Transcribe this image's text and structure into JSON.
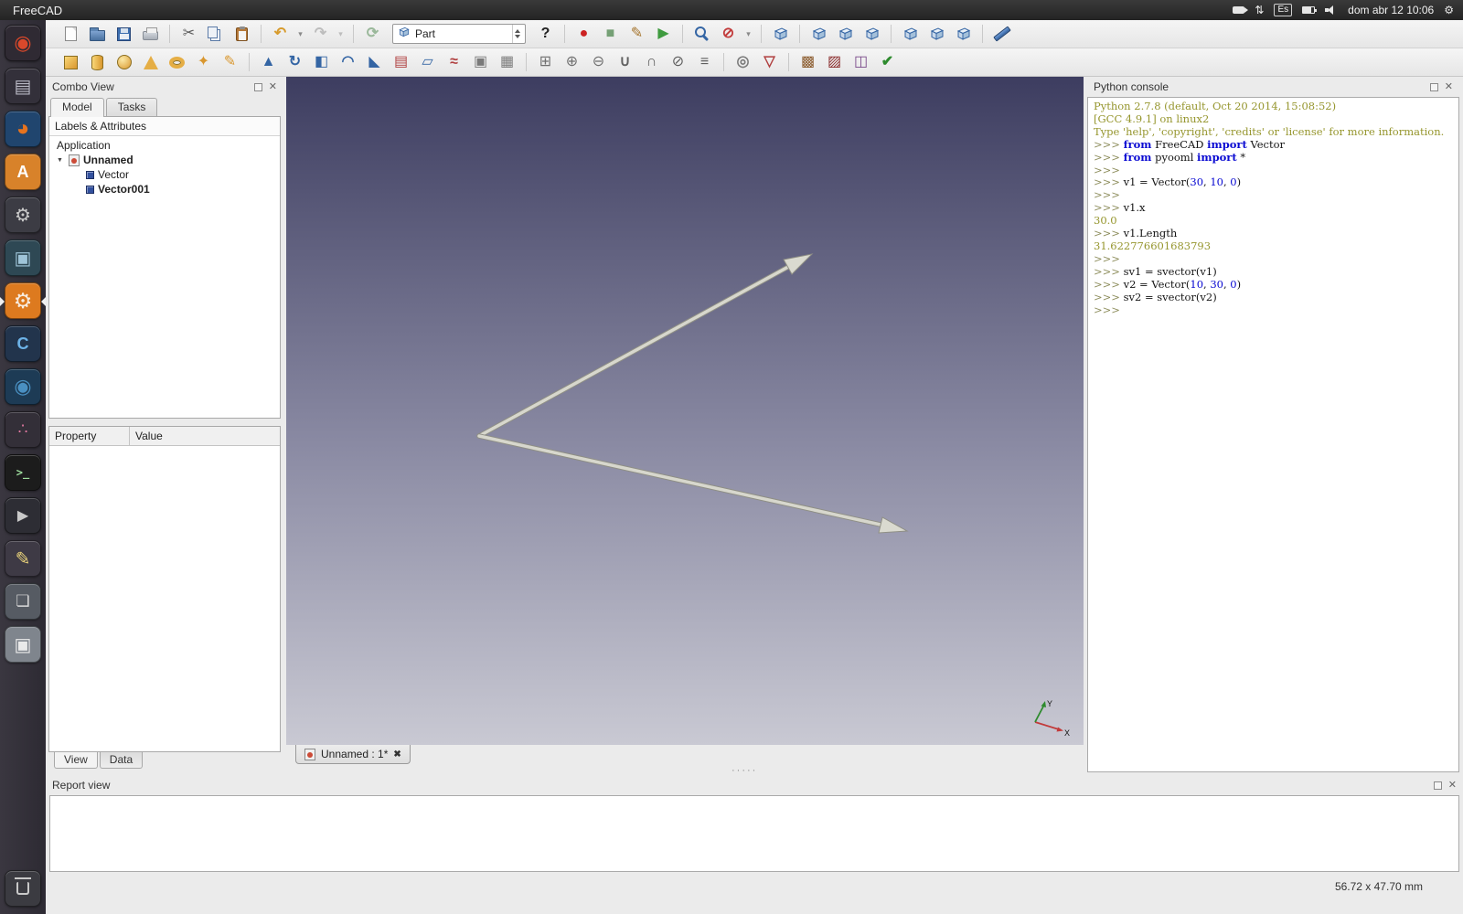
{
  "icons": {
    "close": "✕",
    "close_bold": "✖",
    "expander": "▼",
    "dots": "·····"
  },
  "top_bar": {
    "title": "FreeCAD",
    "indicators": [
      {
        "name": "screen-record-icon",
        "kind": "cls",
        "cls": "tb-cam"
      },
      {
        "name": "network-sync-icon",
        "kind": "glyph",
        "glyph": "⇅"
      },
      {
        "name": "keyboard-layout-indicator",
        "kind": "badge",
        "text": "Es"
      },
      {
        "name": "battery-icon",
        "kind": "cls",
        "cls": "tb-batt"
      },
      {
        "name": "volume-icon",
        "kind": "cls",
        "cls": "tb-vol"
      },
      {
        "name": "clock",
        "kind": "text",
        "text": "dom abr 12 10:06"
      },
      {
        "name": "session-menu-icon",
        "kind": "glyph",
        "glyph": "⚙"
      }
    ]
  },
  "launcher": {
    "items": [
      {
        "name": "launcher-ubuntu-dash",
        "bg": "#2f2a33",
        "glyph": "◉",
        "fg": "#d9482b",
        "size": 22
      },
      {
        "name": "launcher-files",
        "bg": "#33303a",
        "glyph": "▤",
        "fg": "#b9b9c5"
      },
      {
        "name": "launcher-firefox",
        "bg": "#20456e",
        "glyph": "◕",
        "fg": "#e6731e",
        "size": 24
      },
      {
        "name": "launcher-software-center",
        "bg": "#d8822a",
        "glyph": "A",
        "fg": "#ffffff",
        "bold": true,
        "size": 18
      },
      {
        "name": "launcher-system-tools",
        "bg": "#3c3c44",
        "glyph": "⚙",
        "fg": "#c9c9c9"
      },
      {
        "name": "launcher-workspace",
        "bg": "#2e4854",
        "glyph": "▣",
        "fg": "#9fc4d8"
      },
      {
        "name": "launcher-freecad",
        "bg": "#dd7a1f",
        "glyph": "⚙",
        "fg": "#f7ece0",
        "active": true,
        "size": 23
      },
      {
        "name": "launcher-cpp-ide",
        "bg": "#22344c",
        "glyph": "C",
        "fg": "#6db3e8",
        "bold": true,
        "size": 18
      },
      {
        "name": "launcher-web-browser",
        "bg": "#1d3b55",
        "glyph": "◉",
        "fg": "#4a90c2",
        "size": 22
      },
      {
        "name": "launcher-media-app",
        "bg": "#332f38",
        "glyph": "∴",
        "fg": "#e078a0",
        "size": 17
      },
      {
        "name": "launcher-terminal",
        "bg": "#1c1c1c",
        "glyph": ">_",
        "fg": "#9fe09f",
        "mono": true,
        "size": 12,
        "bold": true
      },
      {
        "name": "launcher-video-player",
        "bg": "#2d2d34",
        "glyph": "▶",
        "fg": "#c9c9c9",
        "size": 16
      },
      {
        "name": "launcher-text-editor",
        "bg": "#3e3a45",
        "glyph": "✎",
        "fg": "#e8d27a"
      },
      {
        "name": "launcher-window-manager",
        "bg": "#565b63",
        "glyph": "❏",
        "fg": "#d9d9d9",
        "size": 17
      },
      {
        "name": "launcher-file-manager",
        "bg": "#7f858d",
        "glyph": "▣",
        "fg": "#eaeaea"
      },
      {
        "name": "launcher-trash",
        "bg": "#3b3b41",
        "cls": "bin",
        "trash": true
      }
    ]
  },
  "toolbars": {
    "workbench_selector": "Part",
    "row1_left": [
      {
        "name": "new-document-button",
        "kind": "cls",
        "cls": "ic-doc"
      },
      {
        "name": "open-document-button",
        "kind": "cls",
        "cls": "ic-folder"
      },
      {
        "name": "save-document-button",
        "kind": "cls",
        "cls": "ic-save"
      },
      {
        "name": "print-button",
        "kind": "cls",
        "cls": "ic-print"
      },
      {
        "kind": "sep"
      },
      {
        "name": "cut-button",
        "kind": "glyph",
        "glyph": "✂",
        "color": "#5a5a5a"
      },
      {
        "name": "copy-button",
        "kind": "cls",
        "cls": "ic-copy"
      },
      {
        "name": "paste-button",
        "kind": "cls",
        "cls": "ic-paste"
      },
      {
        "kind": "sep"
      },
      {
        "name": "undo-button",
        "kind": "glyph",
        "glyph": "↶",
        "color": "#d79b2c",
        "bold": true
      },
      {
        "name": "undo-menu-arrow",
        "kind": "glyph",
        "glyph": "▾",
        "color": "#8a8a8a",
        "small": true
      },
      {
        "name": "redo-button",
        "kind": "glyph",
        "glyph": "↷",
        "color": "#bdbdbd",
        "bold": true
      },
      {
        "name": "redo-menu-arrow",
        "kind": "glyph",
        "glyph": "▾",
        "color": "#bdbdbd",
        "small": true
      },
      {
        "kind": "sep"
      },
      {
        "name": "refresh-button",
        "kind": "glyph",
        "glyph": "⟳",
        "color": "#9ab89a",
        "bold": true
      }
    ],
    "row1_right": [
      {
        "name": "whats-this-button",
        "kind": "glyph",
        "glyph": "?",
        "color": "#222222",
        "bold": true
      },
      {
        "kind": "sep"
      },
      {
        "name": "macro-record-button",
        "kind": "glyph",
        "glyph": "●",
        "color": "#cc2222"
      },
      {
        "name": "macro-stop-button",
        "kind": "glyph",
        "glyph": "■",
        "color": "#75a075"
      },
      {
        "name": "macro-edit-button",
        "kind": "glyph",
        "glyph": "✎",
        "color": "#a5742c"
      },
      {
        "name": "macro-execute-button",
        "kind": "glyph",
        "glyph": "▶",
        "color": "#3f9b3f"
      },
      {
        "kind": "sep"
      },
      {
        "name": "fit-all-button",
        "kind": "cls",
        "cls": "ic-zoom"
      },
      {
        "name": "draw-style-button",
        "kind": "glyph",
        "glyph": "⊘",
        "color": "#c23b3b",
        "bold": true
      },
      {
        "name": "draw-style-arrow",
        "kind": "glyph",
        "glyph": "▾",
        "color": "#8a8a8a",
        "small": true
      },
      {
        "kind": "sep"
      },
      {
        "name": "view-axonometric-button",
        "kind": "cube"
      },
      {
        "kind": "sep"
      },
      {
        "name": "view-front-button",
        "kind": "cube"
      },
      {
        "name": "view-top-button",
        "kind": "cube"
      },
      {
        "name": "view-right-button",
        "kind": "cube"
      },
      {
        "kind": "sep"
      },
      {
        "name": "view-rear-button",
        "kind": "cube"
      },
      {
        "name": "view-bottom-button",
        "kind": "cube"
      },
      {
        "name": "view-left-button",
        "kind": "cube"
      },
      {
        "kind": "sep"
      },
      {
        "name": "measure-distance-button",
        "kind": "cls",
        "cls": "ic-ruler"
      }
    ],
    "row2": [
      {
        "name": "part-box-button",
        "kind": "cls",
        "cls": "shp-box"
      },
      {
        "name": "part-cylinder-button",
        "kind": "cls",
        "cls": "shp-cyl"
      },
      {
        "name": "part-sphere-button",
        "kind": "cls",
        "cls": "shp-sph"
      },
      {
        "name": "part-cone-button",
        "kind": "cls",
        "cls": "shp-cone"
      },
      {
        "name": "part-torus-button",
        "kind": "cls",
        "cls": "shp-torus"
      },
      {
        "name": "part-create-primitives-button",
        "kind": "glyph",
        "glyph": "✦",
        "color": "#d9972f"
      },
      {
        "name": "part-shape-builder-button",
        "kind": "glyph",
        "glyph": "✎",
        "color": "#d9972f"
      },
      {
        "kind": "sep"
      },
      {
        "name": "part-extrude-button",
        "kind": "glyph",
        "glyph": "▲",
        "color": "#3465a4"
      },
      {
        "name": "part-revolve-button",
        "kind": "glyph",
        "glyph": "↻",
        "color": "#3465a4",
        "bold": true
      },
      {
        "name": "part-mirror-button",
        "kind": "glyph",
        "glyph": "◧",
        "color": "#3465a4"
      },
      {
        "name": "part-fillet-button",
        "kind": "glyph",
        "glyph": "◠",
        "color": "#3465a4",
        "bold": true
      },
      {
        "name": "part-chamfer-button",
        "kind": "glyph",
        "glyph": "◣",
        "color": "#3465a4"
      },
      {
        "name": "part-ruled-surface-button",
        "kind": "glyph",
        "glyph": "▤",
        "color": "#b04040"
      },
      {
        "name": "part-loft-button",
        "kind": "glyph",
        "glyph": "▱",
        "color": "#3465a4"
      },
      {
        "name": "part-sweep-button",
        "kind": "glyph",
        "glyph": "≈",
        "color": "#b04040",
        "bold": true
      },
      {
        "name": "part-offset-button",
        "kind": "glyph",
        "glyph": "▣",
        "color": "#7a7a7a"
      },
      {
        "name": "part-thickness-button",
        "kind": "glyph",
        "glyph": "▦",
        "color": "#7a7a7a"
      },
      {
        "kind": "sep"
      },
      {
        "name": "part-compound-button",
        "kind": "glyph",
        "glyph": "⊞",
        "color": "#6f6f6f"
      },
      {
        "name": "part-boolean-button",
        "kind": "glyph",
        "glyph": "⊕",
        "color": "#6f6f6f"
      },
      {
        "name": "part-cut-button",
        "kind": "glyph",
        "glyph": "⊖",
        "color": "#6f6f6f"
      },
      {
        "name": "part-union-button",
        "kind": "glyph",
        "glyph": "∪",
        "color": "#5f5f5f",
        "bold": true
      },
      {
        "name": "part-common-button",
        "kind": "glyph",
        "glyph": "∩",
        "color": "#5f5f5f",
        "bold": true
      },
      {
        "name": "part-section-button",
        "kind": "glyph",
        "glyph": "⊘",
        "color": "#5f5f5f"
      },
      {
        "name": "part-cross-sections-button",
        "kind": "glyph",
        "glyph": "≡",
        "color": "#5f5f5f",
        "bold": true
      },
      {
        "kind": "sep"
      },
      {
        "name": "part-3d-offset-button",
        "kind": "glyph",
        "glyph": "◎",
        "color": "#7a7a7a",
        "bold": true
      },
      {
        "name": "part-defeaturing-button",
        "kind": "glyph",
        "glyph": "▽",
        "color": "#b04040",
        "bold": true
      },
      {
        "kind": "sep"
      },
      {
        "name": "part-shape-from-mesh-button",
        "kind": "glyph",
        "glyph": "▩",
        "color": "#8a5a2c"
      },
      {
        "name": "part-convert-to-solid-button",
        "kind": "glyph",
        "glyph": "▨",
        "color": "#8a2c2c"
      },
      {
        "name": "part-reverse-shapes-button",
        "kind": "glyph",
        "glyph": "◫",
        "color": "#7a4a8a"
      },
      {
        "name": "part-check-geometry-button",
        "kind": "glyph",
        "glyph": "✔",
        "color": "#2e8b2e",
        "bold": true
      }
    ]
  },
  "combo_view": {
    "title": "Combo View",
    "tabs": [
      "Model",
      "Tasks"
    ],
    "section_header": "Labels & Attributes",
    "tree": {
      "root_label": "Application",
      "document_label": "Unnamed",
      "items": [
        {
          "label": "Vector",
          "bold": false
        },
        {
          "label": "Vector001",
          "bold": true
        }
      ]
    },
    "property_headers": [
      "Property",
      "Value"
    ],
    "bottom_tabs": [
      "View",
      "Data"
    ]
  },
  "document_tab": {
    "label": "Unnamed : 1*"
  },
  "python_console": {
    "title": "Python console",
    "lines": [
      [
        {
          "t": "Python 2.7.8 (default, Oct 20 2014, 15:08:52)",
          "c": "sys"
        }
      ],
      [
        {
          "t": "[GCC 4.9.1] on linux2",
          "c": "sys"
        }
      ],
      [
        {
          "t": "Type 'help', 'copyright', 'credits' or 'license' for more information.",
          "c": "sys"
        }
      ],
      [
        {
          "t": ">>> ",
          "c": "prompt"
        },
        {
          "t": "from",
          "c": "kw"
        },
        {
          "t": " FreeCAD ",
          "c": "txt"
        },
        {
          "t": "import",
          "c": "kw"
        },
        {
          "t": " Vector",
          "c": "txt"
        }
      ],
      [
        {
          "t": ">>> ",
          "c": "prompt"
        },
        {
          "t": "from",
          "c": "kw"
        },
        {
          "t": " pyooml ",
          "c": "txt"
        },
        {
          "t": "import",
          "c": "kw"
        },
        {
          "t": " *",
          "c": "txt"
        }
      ],
      [
        {
          "t": ">>> ",
          "c": "prompt"
        }
      ],
      [
        {
          "t": ">>> ",
          "c": "prompt"
        },
        {
          "t": "v1 = Vector(",
          "c": "txt"
        },
        {
          "t": "30",
          "c": "num"
        },
        {
          "t": ", ",
          "c": "txt"
        },
        {
          "t": "10",
          "c": "num"
        },
        {
          "t": ", ",
          "c": "txt"
        },
        {
          "t": "0",
          "c": "num"
        },
        {
          "t": ")",
          "c": "txt"
        }
      ],
      [
        {
          "t": ">>> ",
          "c": "prompt"
        }
      ],
      [
        {
          "t": ">>> ",
          "c": "prompt"
        },
        {
          "t": "v1.x",
          "c": "txt"
        }
      ],
      [
        {
          "t": "30.0",
          "c": "out"
        }
      ],
      [
        {
          "t": ">>> ",
          "c": "prompt"
        },
        {
          "t": "v1.Length",
          "c": "txt"
        }
      ],
      [
        {
          "t": "31.622776601683793",
          "c": "out"
        }
      ],
      [
        {
          "t": ">>> ",
          "c": "prompt"
        }
      ],
      [
        {
          "t": ">>> ",
          "c": "prompt"
        },
        {
          "t": "sv1 = svector(v1)",
          "c": "txt"
        }
      ],
      [
        {
          "t": ">>> ",
          "c": "prompt"
        },
        {
          "t": "v2 = Vector(",
          "c": "txt"
        },
        {
          "t": "10",
          "c": "num"
        },
        {
          "t": ", ",
          "c": "txt"
        },
        {
          "t": "30",
          "c": "num"
        },
        {
          "t": ", ",
          "c": "txt"
        },
        {
          "t": "0",
          "c": "num"
        },
        {
          "t": ")",
          "c": "txt"
        }
      ],
      [
        {
          "t": ">>> ",
          "c": "prompt"
        },
        {
          "t": "sv2 = svector(v2)",
          "c": "txt"
        }
      ],
      [
        {
          "t": ">>> ",
          "c": "prompt"
        }
      ]
    ]
  },
  "report_view": {
    "title": "Report view"
  },
  "status_bar": {
    "size_indicator": "56.72 x 47.70 mm"
  },
  "viewport": {
    "background_top": "#3d3d60",
    "background_mid": "#8a8aa3",
    "background_bottom": "#c9c9d3",
    "axis_labels": {
      "x": "X",
      "y": "Y"
    },
    "vectors": [
      {
        "name": "vector-v1-arrow",
        "shaft": [
          [
            211,
            393
          ],
          [
            549,
            208
          ]
        ],
        "head": [
          [
            575,
            194
          ],
          [
            553,
            216
          ],
          [
            544,
            200
          ]
        ]
      },
      {
        "name": "vector-v2-arrow",
        "shaft": [
          [
            211,
            393
          ],
          [
            650,
            490
          ]
        ],
        "head": [
          [
            679,
            497
          ],
          [
            648,
            499
          ],
          [
            652,
            482
          ]
        ]
      }
    ]
  }
}
